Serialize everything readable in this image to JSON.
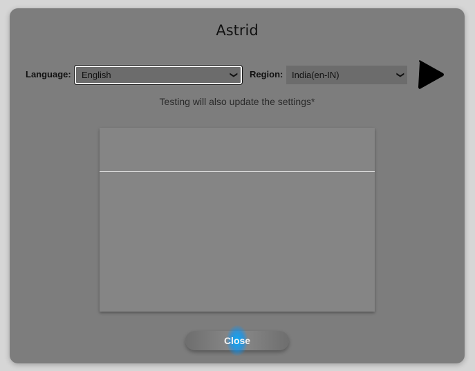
{
  "dialog": {
    "title": "Astrid",
    "language": {
      "label": "Language:",
      "selected": "English"
    },
    "region": {
      "label": "Region:",
      "selected": "India(en-IN)"
    },
    "play_icon": "play-icon",
    "note": "Testing will also update the settings*",
    "close_label": "Close",
    "colors": {
      "dialog_bg": "#7d7d7d",
      "close_glow": "#00aaff"
    }
  }
}
